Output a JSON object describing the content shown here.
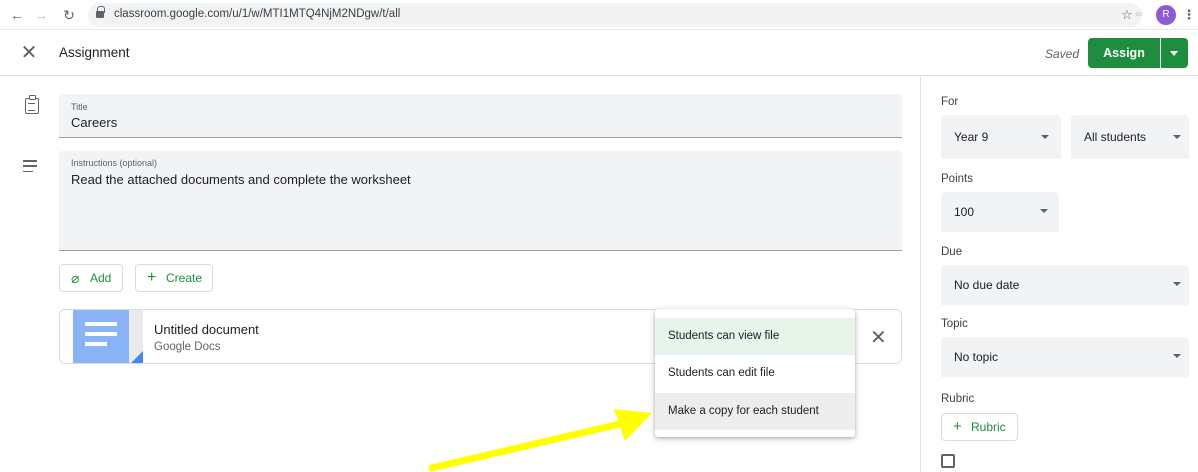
{
  "browser": {
    "url": "classroom.google.com/u/1/w/MTI1MTQ4NjM2NDgw/t/all",
    "avatar_letter": "R"
  },
  "header": {
    "title": "Assignment",
    "saved_label": "Saved",
    "assign_label": "Assign"
  },
  "form": {
    "title_label": "Title",
    "title_value": "Careers",
    "instructions_label": "Instructions (optional)",
    "instructions_value": "Read the attached documents and complete the worksheet",
    "add_label": "Add",
    "create_label": "Create"
  },
  "attachment": {
    "name": "Untitled document",
    "type": "Google Docs"
  },
  "share_menu": {
    "items": [
      "Students can view file",
      "Students can edit file",
      "Make a copy for each student"
    ],
    "selected": "Students can view file"
  },
  "sidebar": {
    "for_label": "For",
    "class_value": "Year 9",
    "students_value": "All students",
    "points_label": "Points",
    "points_value": "100",
    "due_label": "Due",
    "due_value": "No due date",
    "topic_label": "Topic",
    "topic_value": "No topic",
    "rubric_label": "Rubric",
    "rubric_button": "Rubric"
  },
  "colors": {
    "accent_green": "#1e8e3e",
    "selected_item_bg": "#e6f4ea",
    "annotation_arrow": "#ffff00"
  }
}
